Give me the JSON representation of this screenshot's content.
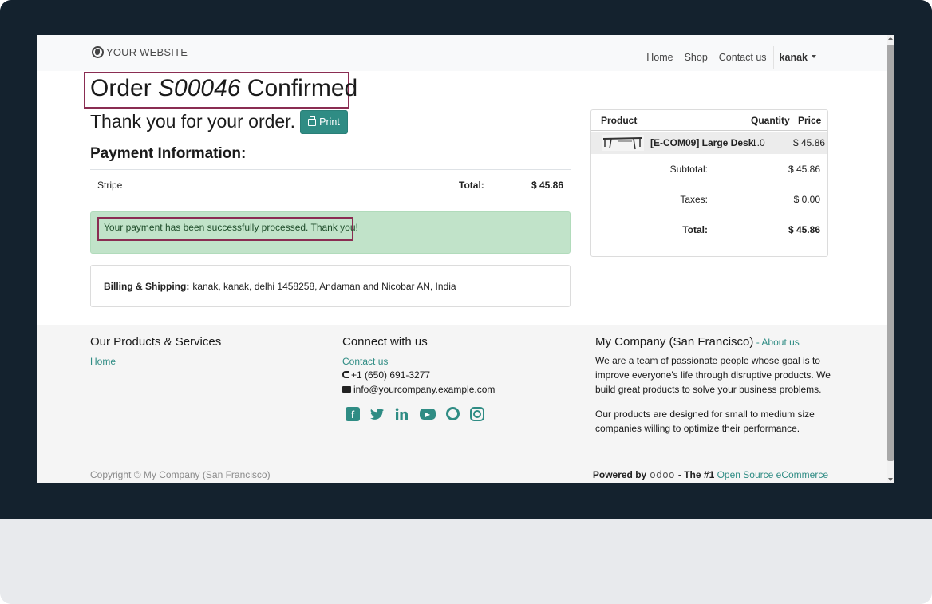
{
  "header": {
    "brand": "YOUR WEBSITE",
    "nav": {
      "home": "Home",
      "shop": "Shop",
      "contact": "Contact us",
      "user": "kanak"
    }
  },
  "order": {
    "title_prefix": "Order ",
    "order_number": "S00046",
    "title_suffix": " Confirmed",
    "thanks": "Thank you for your order.",
    "print_label": "Print"
  },
  "payment": {
    "heading": "Payment Information:",
    "method": "Stripe",
    "total_label": "Total:",
    "total_value": "$ 45.86",
    "success_message": "Your payment has been successfully processed. Thank you!"
  },
  "billing": {
    "label": "Billing & Shipping:",
    "address": "kanak, kanak, delhi 1458258, Andaman and Nicobar AN, India"
  },
  "summary": {
    "columns": {
      "product": "Product",
      "quantity": "Quantity",
      "price": "Price"
    },
    "item": {
      "name": "[E-COM09] Large Desk",
      "quantity": "1.0",
      "price": "$ 45.86"
    },
    "subtotal_label": "Subtotal:",
    "subtotal_value": "$ 45.86",
    "taxes_label": "Taxes:",
    "taxes_value": "$ 0.00",
    "total_label": "Total:",
    "total_value": "$ 45.86"
  },
  "footer": {
    "products_title": "Our Products & Services",
    "products_link": "Home",
    "connect_title": "Connect with us",
    "connect_link": "Contact us",
    "phone": "+1 (650) 691-3277",
    "email": "info@yourcompany.example.com",
    "social_icons": [
      "facebook-icon",
      "twitter-icon",
      "linkedin-icon",
      "youtube-icon",
      "github-icon",
      "instagram-icon"
    ],
    "company_title": "My Company (San Francisco)",
    "company_sep": " - ",
    "about_link": "About us",
    "about_text_1": "We are a team of passionate people whose goal is to improve everyone's life through disruptive products. We build great products to solve your business problems.",
    "about_text_2": "Our products are designed for small to medium size companies willing to optimize their performance.",
    "copyright": "Copyright © My Company (San Francisco)",
    "powered_by": "Powered by",
    "odoo": "odoo",
    "tagline": "- The #1",
    "ecommerce_link": "Open Source eCommerce"
  },
  "colors": {
    "accent": "#2f8c84",
    "highlight_border": "#8a2d52",
    "success_bg": "#c1e3c9",
    "frame": "#14222e"
  }
}
